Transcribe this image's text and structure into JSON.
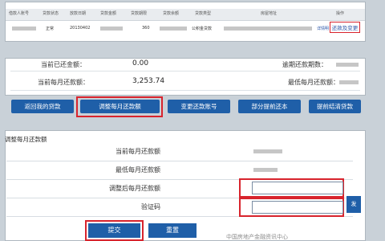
{
  "loan_table": {
    "headers": [
      "借款人账号",
      "贷款状态",
      "放款日期",
      "贷款金额",
      "贷款期限",
      "贷款余额",
      "贷款类型",
      "房屋地址",
      "操作"
    ],
    "row": {
      "status": "正常",
      "date": "20130402",
      "amount_suffix": "360",
      "type": "公积金贷款",
      "detail_link": "详情",
      "other_link": "明",
      "repay_button": "还款及变更"
    }
  },
  "summary": {
    "row1_label": "当前已还金额：",
    "row1_value": "0.00",
    "row1_right_label": "逾期还款期数：",
    "row2_label": "当前每月还款额：",
    "row2_value": "3,253.74",
    "row2_right_label": "最低每月还款额："
  },
  "actions": {
    "back": "返回我的贷款",
    "adjust": "调整每月还款额",
    "change_account": "变更还款账号",
    "partial_prepay": "部分提前还本",
    "full_prepay": "提前结清贷款"
  },
  "adjust_form": {
    "title": "调整每月还款额",
    "current_label": "当前每月还款额",
    "min_label": "最低每月还款额",
    "adjusted_label": "调整后每月还款额",
    "adjusted_value": "",
    "code_label": "验证码",
    "code_value": "",
    "send_button": "发",
    "submit": "提交",
    "reset": "重置"
  },
  "watermark": "中国房地产金融资讯中心"
}
